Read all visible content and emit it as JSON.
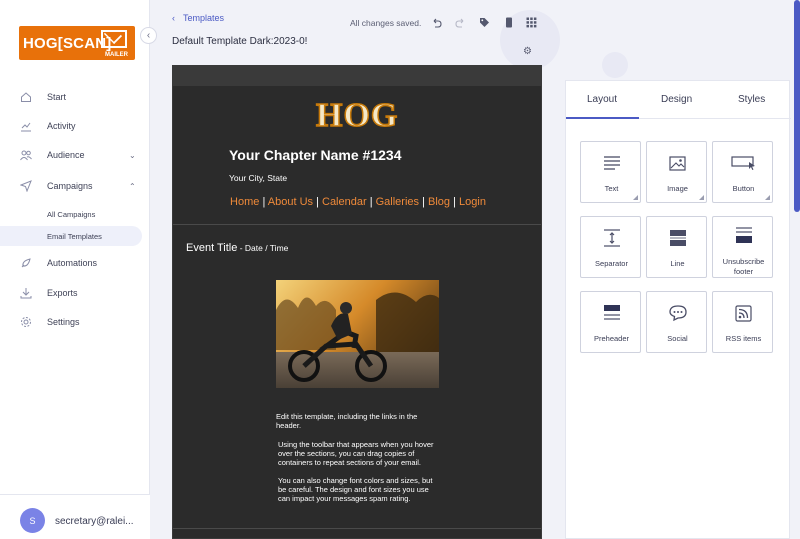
{
  "logo": {
    "text": "HOG[SCAN]",
    "sub": "MAILER"
  },
  "nav": {
    "items": [
      {
        "label": "Start",
        "icon": "home-icon"
      },
      {
        "label": "Activity",
        "icon": "chart-icon"
      },
      {
        "label": "Audience",
        "icon": "users-icon"
      },
      {
        "label": "Campaigns",
        "icon": "send-icon"
      },
      {
        "label": "Automations",
        "icon": "rocket-icon"
      },
      {
        "label": "Exports",
        "icon": "download-icon"
      },
      {
        "label": "Settings",
        "icon": "gear-icon"
      }
    ],
    "sub_items": [
      "All Campaigns",
      "Email Templates"
    ]
  },
  "user": {
    "initial": "S",
    "email": "secretary@ralei..."
  },
  "header": {
    "breadcrumb": "Templates",
    "title": "Default Template Dark:2023-0!",
    "save_status": "All changes saved."
  },
  "email": {
    "logo_text": "HOG",
    "chapter_name": "Your Chapter Name #1234",
    "city": "Your City, State",
    "nav_links": [
      "Home",
      "About Us",
      "Calendar",
      "Galleries",
      "Blog",
      "Login"
    ],
    "nav_sep": "|",
    "event_title": "Event Title",
    "event_dt": " - Date / Time",
    "para1": "Edit this template, including the links in the header.",
    "para2": "Using the toolbar that appears when you hover over the sections, you can drag copies of containers to repeat sections of your email.",
    "para3": "You can also change font colors and sizes, but be careful.  The design and font sizes you use can impact your messages spam rating."
  },
  "panel": {
    "tabs": [
      "Layout",
      "Design",
      "Styles"
    ],
    "blocks": [
      {
        "label": "Text",
        "icon": "text-icon"
      },
      {
        "label": "Image",
        "icon": "image-icon"
      },
      {
        "label": "Button",
        "icon": "button-icon"
      },
      {
        "label": "Separator",
        "icon": "separator-icon"
      },
      {
        "label": "Line",
        "icon": "line-icon"
      },
      {
        "label": "Unsubscribe footer",
        "icon": "unsubscribe-footer-icon"
      },
      {
        "label": "Preheader",
        "icon": "preheader-icon"
      },
      {
        "label": "Social",
        "icon": "social-icon"
      },
      {
        "label": "RSS items",
        "icon": "rss-icon"
      }
    ]
  },
  "colors": {
    "accent": "#4b5ac4",
    "brand": "#e8710a",
    "email_bg": "#2b2b2b",
    "link": "#ef8a3a"
  }
}
